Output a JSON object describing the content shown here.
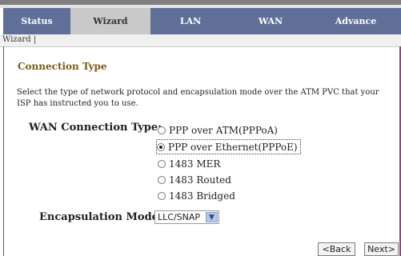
{
  "tabs": [
    {
      "label": "Status",
      "active": false
    },
    {
      "label": "Wizard",
      "active": true
    },
    {
      "label": "LAN",
      "active": false
    },
    {
      "label": "WAN",
      "active": false
    },
    {
      "label": "Advance",
      "active": false
    }
  ],
  "subnav": {
    "label": "Wizard |"
  },
  "content": {
    "title": "Connection Type",
    "description": "Select the type of network protocol and encapsulation mode over the ATM PVC that your ISP has instructed you to use.",
    "wan_label": "WAN Connection Type:",
    "options": [
      {
        "label": "PPP over ATM(PPPoA)",
        "selected": false
      },
      {
        "label": "PPP over Ethernet(PPPoE)",
        "selected": true
      },
      {
        "label": "1483 MER",
        "selected": false
      },
      {
        "label": "1483 Routed",
        "selected": false
      },
      {
        "label": "1483 Bridged",
        "selected": false
      }
    ],
    "encap_label": "Encapsulation Mode:",
    "encap_value": "LLC/SNAP"
  },
  "buttons": {
    "back": "<Back",
    "next": "Next>"
  },
  "colors": {
    "tabbar": "#5f6f98",
    "tab_active": "#c9c9c9",
    "title": "#7a5a18",
    "frame": "#8a4b7a"
  }
}
